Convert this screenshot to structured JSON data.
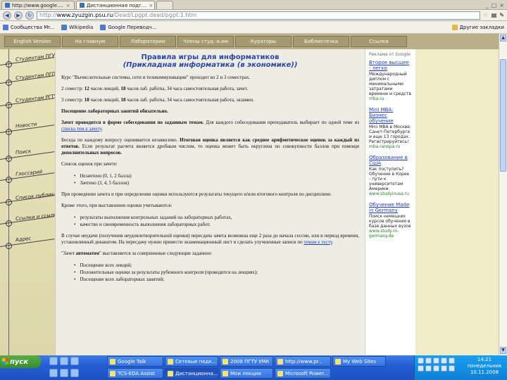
{
  "browser": {
    "tabs": [
      {
        "label": "http://www.google....",
        "active": false
      },
      {
        "label": "Дистанционная подг...",
        "active": true
      },
      {
        "label": "",
        "active": false
      }
    ],
    "url_prefix": "http://",
    "url_domain": "www.zyuzgin.psu.ru",
    "url_path": "/Dead/Lpgpt.dead/pgpt.1.htm",
    "bookmarks": [
      {
        "label": "Сообщества Mr..."
      },
      {
        "label": "Wikipedia"
      },
      {
        "label": "Google Переводч..."
      }
    ],
    "other_bookmarks": "Другие закладки"
  },
  "topnav": {
    "items": [
      "English Version",
      "На главную",
      "Лаборатории",
      "Члены студ.-в.им",
      "Кураторы",
      "Библиотечка",
      "Ссылки"
    ]
  },
  "sidebar": {
    "items": [
      "Студентам ПГУ",
      "Студентам ПГПУ",
      "Студентам PГТУ",
      "Новости",
      "Поиск",
      "Глоссарий",
      "Список публикаций",
      "Ссылки и ссылки",
      "Адрес"
    ]
  },
  "content": {
    "title": "Правила игры для информатиков",
    "subtitle": "(Прикладная информатика (в экономике))",
    "p1": "Курс \"Вычислительные системы, сети и телекоммуникации\" проходит во 2 и 3 семестрах.",
    "p2_a": "2 семестр: ",
    "p2_b": "12",
    "p2_c": " часов лекций, ",
    "p2_d": "18",
    "p2_e": " часов лаб. работы, 34 часа самостоятельная работа, зачет.",
    "p3_a": "3 семестр: ",
    "p3_b": "18",
    "p3_c": " часов лекций, ",
    "p3_d": "18",
    "p3_e": " часов лаб. работы, 34 часа самостоятельная работа, экзамен.",
    "p4": "Посещение лабораторных занятий обязательно.",
    "p5_a": "Зачет проводится в форме собеседования по заданным темам.",
    "p5_b": " Для каждого собеседования преподаватель выбирает по одной теме из ",
    "p5_link": "списка тем к зачету",
    "p5_c": ".",
    "p6_a": "Беседа по каждому вопросу оценивается независимо. ",
    "p6_b": "Итоговая оценка является как среднее арифметическое оценок за каждый из ответов.",
    "p6_c": " Если результат расчета является дробным числом, то оценка может быть округлена по совокупности баллов при помощи ",
    "p6_d": "дополнительных вопросов.",
    "p7": "Список оценок при зачете:",
    "list1": [
      "Незачтено (0, 1, 2 балла)",
      "Зачтено (3, 4, 5 баллов)"
    ],
    "p8": "При проведении зачета и при определении оценки используются результаты текущего и/или итогового контроля по дисциплине.",
    "p9": "Кроме этого, при выставлении оценки учитываются:",
    "list2": [
      "результаты выполнения контрольных заданий на лабораторных работах,",
      "качество и своевременность выполнения лабораторных работ."
    ],
    "p10_a": "В случае неудачи (получения неудовлетворительной оценки) пересдача зачета возможна еще 2 раза до начала сессии, или в период времени, установленный деканатом. На пересдачу нужно принести экзаменационный лист и сделать улучшенные записи по ",
    "p10_link": "темам к тесту",
    "p10_b": ".",
    "p11_a": "\"Зачет ",
    "p11_b": "автоматом",
    "p11_c": "\" выставляется за совершенные следующие заданное:",
    "list3": [
      "Посещение всех лекций;",
      "Положительные оценки за результаты рубежного контроля (проводится на лекциях);",
      "Посещение всех лабораторных занятий;"
    ]
  },
  "ads": {
    "header": "Реклама от Google",
    "items": [
      {
        "title": "Второе высшее - легко",
        "desc": "Международный диплом с минимальными затратами времени и средств",
        "url": "mba.ru"
      },
      {
        "title": "Mini MBA. Бизнес обучение",
        "desc": "Mini MBA в Москве. Санкт-Петербурге и еще 13 городах. Регистрируйтесь!",
        "url": "mba.ranepa.ru"
      },
      {
        "title": "Образование в США",
        "desc": "Как поступить? Обучение в Корее - пути к университетам Америки.",
        "url": "www.studyinusa.ru"
      },
      {
        "title": "Обучение Made in Germany",
        "desc": "Поиск немецких курсов обучения в базе данных вузов",
        "url": "www.study-in-germany.de"
      }
    ]
  },
  "taskbar": {
    "start": "пуск",
    "buttons": [
      {
        "label": "Google Talk",
        "active": false
      },
      {
        "label": "Сетевые подк...",
        "active": false
      },
      {
        "label": "2008 ПГТУ УМК",
        "active": false
      },
      {
        "label": "http://www.pr...",
        "active": false
      },
      {
        "label": "My Web Sites",
        "active": false
      },
      {
        "label": "TCS-EDA Assist",
        "active": false
      },
      {
        "label": "Дистанционна...",
        "active": true
      },
      {
        "label": "Мои лекции",
        "active": false
      },
      {
        "label": "Microsoft Power...",
        "active": false
      }
    ],
    "clock_time": "14:21",
    "clock_day": "понедельник",
    "clock_date": "10.11.2008"
  }
}
